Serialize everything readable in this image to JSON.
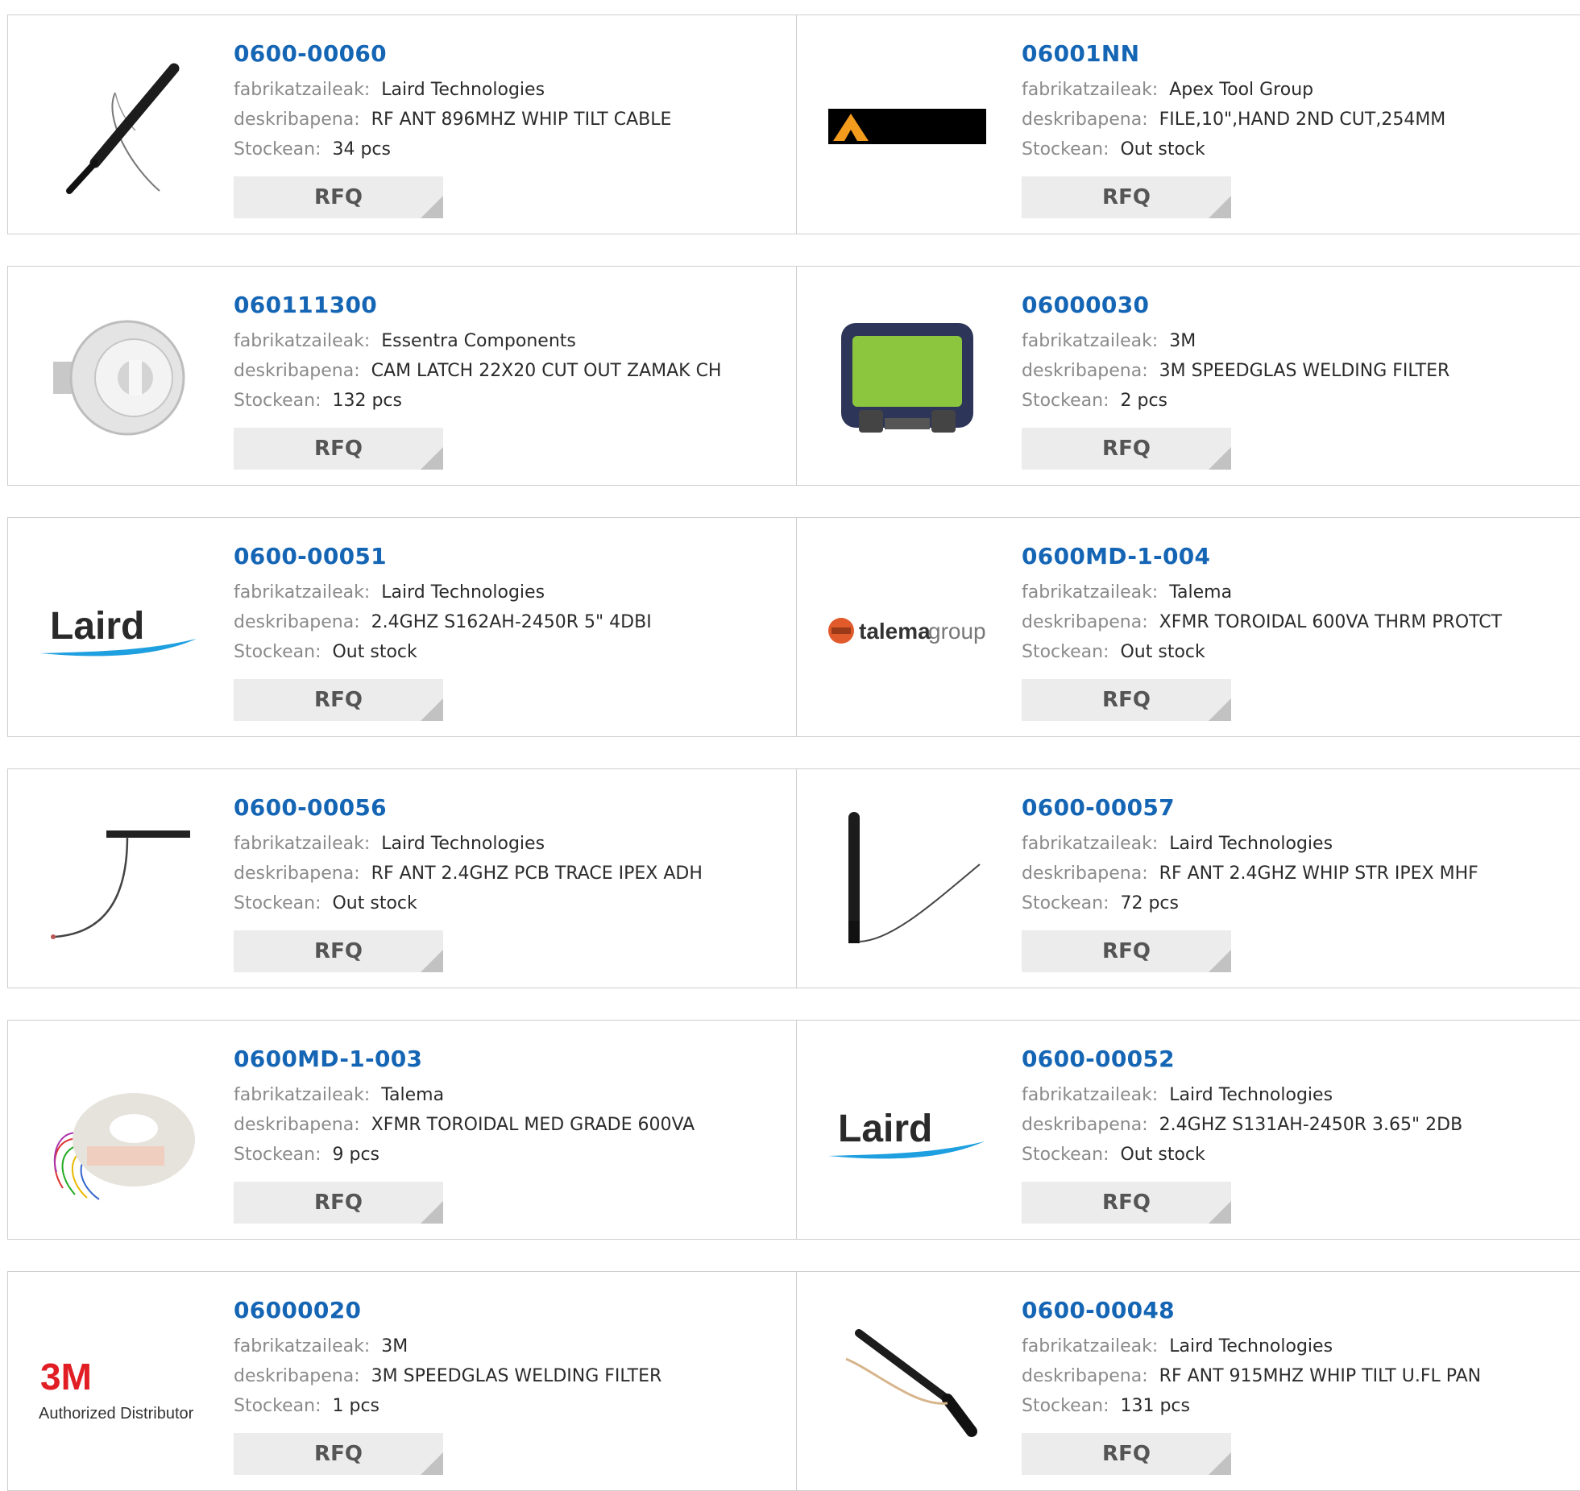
{
  "labels": {
    "manufacturer": "fabrikatzaileak:",
    "description": "deskribapena:",
    "stock": "Stockean:",
    "rfq": "RFQ"
  },
  "logos": {
    "laird": "Laird",
    "talema_main": "talema",
    "talema_group": "group",
    "threem_logo": "3M",
    "threem_sub": "Authorized Distributor"
  },
  "colors": {
    "part_link": "#1565b5",
    "label_gray": "#8a8a8a",
    "rfq_bg": "#ececec"
  },
  "products": [
    {
      "part": "0600-00060",
      "manufacturer": "Laird Technologies",
      "description": "RF ANT 896MHZ WHIP TILT CABLE",
      "stock": "34 pcs",
      "image": "whip-antenna-tilt-cable"
    },
    {
      "part": "06001NN",
      "manufacturer": "Apex Tool Group",
      "description": "FILE,10\",HAND 2ND CUT,254MM",
      "stock": "Out stock",
      "image": "apex-logo-bar"
    },
    {
      "part": "060111300",
      "manufacturer": "Essentra Components",
      "description": "CAM LATCH 22X20 CUT OUT ZAMAK CH",
      "stock": "132 pcs",
      "image": "cam-latch"
    },
    {
      "part": "06000030",
      "manufacturer": "3M",
      "description": "3M SPEEDGLAS WELDING FILTER",
      "stock": "2 pcs",
      "image": "welding-filter"
    },
    {
      "part": "0600-00051",
      "manufacturer": "Laird Technologies",
      "description": "2.4GHZ S162AH-2450R 5\" 4DBI",
      "stock": "Out stock",
      "image": "laird-logo"
    },
    {
      "part": "0600MD-1-004",
      "manufacturer": "Talema",
      "description": "XFMR TOROIDAL 600VA THRM PROTCT",
      "stock": "Out stock",
      "image": "talema-logo"
    },
    {
      "part": "0600-00056",
      "manufacturer": "Laird Technologies",
      "description": "RF ANT 2.4GHZ PCB TRACE IPEX ADH",
      "stock": "Out stock",
      "image": "pcb-trace-antenna"
    },
    {
      "part": "0600-00057",
      "manufacturer": "Laird Technologies",
      "description": "RF ANT 2.4GHZ WHIP STR IPEX MHF",
      "stock": "72 pcs",
      "image": "whip-antenna-straight"
    },
    {
      "part": "0600MD-1-003",
      "manufacturer": "Talema",
      "description": "XFMR TOROIDAL MED GRADE 600VA",
      "stock": "9 pcs",
      "image": "toroidal-transformer"
    },
    {
      "part": "0600-00052",
      "manufacturer": "Laird Technologies",
      "description": "2.4GHZ S131AH-2450R 3.65\" 2DB",
      "stock": "Out stock",
      "image": "laird-logo"
    },
    {
      "part": "06000020",
      "manufacturer": "3M",
      "description": "3M SPEEDGLAS WELDING FILTER",
      "stock": "1 pcs",
      "image": "3m-logo"
    },
    {
      "part": "0600-00048",
      "manufacturer": "Laird Technologies",
      "description": "RF ANT 915MHZ WHIP TILT U.FL PAN",
      "stock": "131 pcs",
      "image": "whip-antenna-tilt"
    }
  ]
}
